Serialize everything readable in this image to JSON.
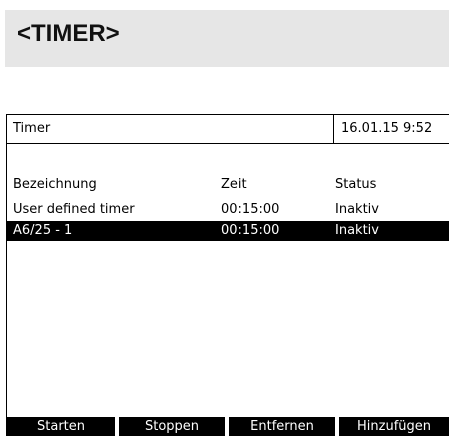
{
  "heading": "<TIMER>",
  "window": {
    "title": "Timer",
    "datetime": "16.01.15  9:52"
  },
  "columns": {
    "name": "Bezeichnung",
    "time": "Zeit",
    "status": "Status"
  },
  "rows": [
    {
      "name": "User defined timer",
      "time": "00:15:00",
      "status": "Inaktiv",
      "selected": false
    },
    {
      "name": "A6/25 - 1",
      "time": "00:15:00",
      "status": "Inaktiv",
      "selected": true
    }
  ],
  "softkeys": {
    "start": "Starten",
    "stop": "Stoppen",
    "remove": "Entfernen",
    "add": "Hinzufügen"
  },
  "colors": {
    "heading_band": "#e6e6e6",
    "selection": "#000000",
    "softkey_bg": "#000000",
    "softkey_text": "#ffffff"
  }
}
